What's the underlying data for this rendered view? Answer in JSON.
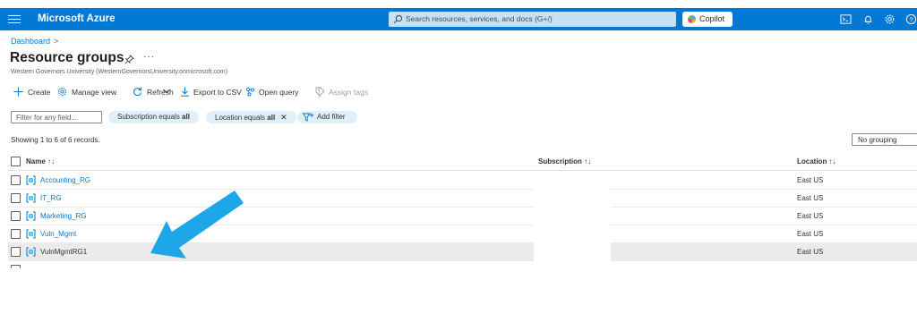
{
  "topbar": {
    "brand": "Microsoft Azure",
    "search_placeholder": "Search resources, services, and docs (G+/)",
    "copilot_label": "Copilot",
    "accent": "#0078d4"
  },
  "breadcrumb": {
    "item": "Dashboard",
    "sep": ">"
  },
  "page": {
    "title": "Resource groups",
    "more": "···",
    "subtitle": "Western Governors University (WesternGovernorsUniversity.onmicrosoft.com)"
  },
  "commands": {
    "create": "Create",
    "manage_view": "Manage view",
    "refresh": "Refresh",
    "export_csv": "Export to CSV",
    "open_query": "Open query",
    "assign_tags": "Assign tags"
  },
  "filters": {
    "input_placeholder": "Filter for any field...",
    "subscription_prefix": "Subscription equals ",
    "subscription_value": "all",
    "location_prefix": "Location equals ",
    "location_value": "all",
    "add_filter": "Add filter"
  },
  "records_text": "Showing 1 to 6 of 6 records.",
  "grouping_value": "No grouping",
  "columns": {
    "name": "Name ↑↓",
    "subscription": "Subscription ↑↓",
    "location": "Location ↑↓"
  },
  "rows": [
    {
      "name": "Accounting_RG",
      "location": "East US"
    },
    {
      "name": "IT_RG",
      "location": "East US"
    },
    {
      "name": "Marketing_RG",
      "location": "East US"
    },
    {
      "name": "Vuln_Mgmt",
      "location": "East US"
    },
    {
      "name": "VulnMgmtRG1",
      "location": "East US"
    }
  ],
  "annotation_arrow_color": "#1ea7e8"
}
